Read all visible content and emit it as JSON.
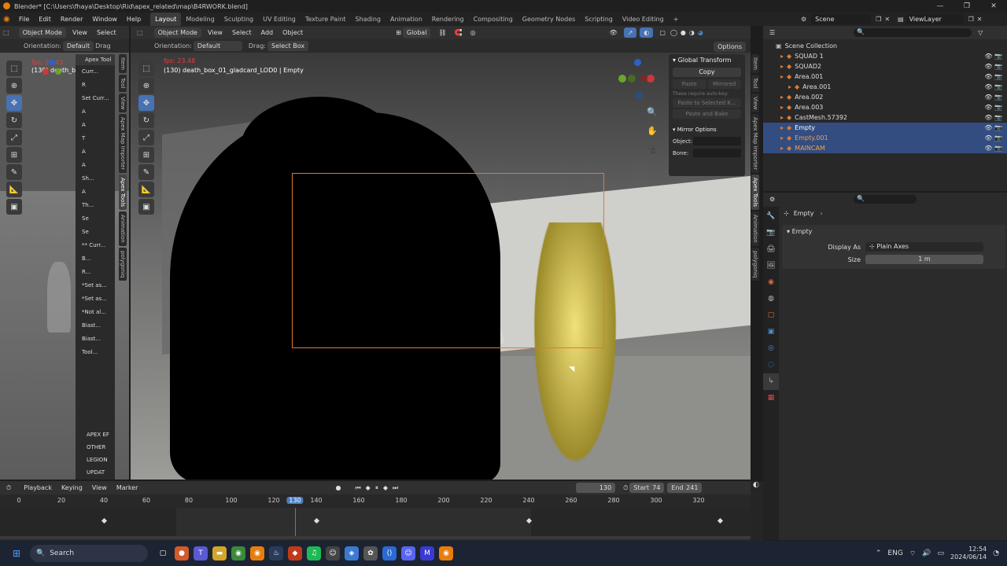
{
  "window": {
    "title": "Blender* [C:\\Users\\fhaya\\Desktop\\Rid\\apex_related\\map\\B4RWORK.blend]",
    "controls": [
      "—",
      "❐",
      "✕"
    ]
  },
  "menu": [
    "File",
    "Edit",
    "Render",
    "Window",
    "Help"
  ],
  "workspaces": [
    "Layout",
    "Modeling",
    "Sculpting",
    "UV Editing",
    "Texture Paint",
    "Shading",
    "Animation",
    "Rendering",
    "Compositing",
    "Geometry Nodes",
    "Scripting",
    "Video Editing"
  ],
  "scene": {
    "name": "Scene",
    "view_layer": "ViewLayer"
  },
  "left_view": {
    "mode": "Object Mode",
    "menus": [
      "View",
      "Select"
    ],
    "orientation_label": "Orientation:",
    "orientation": "Default",
    "drag": "Drag",
    "fps": "fps: 23.43",
    "info": "(130) death_box",
    "apex_tab": "Apex Tool",
    "rows": [
      "Curr...",
      "R",
      "Set Curr...",
      "A",
      "A",
      "T",
      "A",
      "A",
      "Sh...",
      "A",
      "Th...",
      "Se",
      "Se",
      "** Curr...",
      "B...",
      "R...",
      "*Set as...",
      "*Set as...",
      "*Not al...",
      "Biast...",
      "Biast...",
      "Tool..."
    ],
    "sections": [
      "APEX EF",
      "OTHER",
      "LEGION",
      "UPDAT"
    ]
  },
  "main_view": {
    "mode": "Object Mode",
    "menus": [
      "View",
      "Select",
      "Add",
      "Object"
    ],
    "transform": "Global",
    "orientation_label": "Orientation:",
    "orientation": "Default",
    "drag_label": "Drag:",
    "drag": "Select Box",
    "options": "Options",
    "fps": "fps: 23.48",
    "info": "(130) death_box_01_gladcard_LOD0 | Empty"
  },
  "side_tabs_left": [
    "Item",
    "Tool",
    "View",
    "Apex Map Importer",
    "Apex Tools",
    "Animation",
    "polygoniq"
  ],
  "side_tabs_main": [
    "Item",
    "Tool",
    "View",
    "Apex Map Importer",
    "Apex Tools",
    "Animation",
    "polygoniq"
  ],
  "npanel": {
    "global_title": "Global Transform",
    "copy": "Copy",
    "paste": "Paste",
    "mirrored": "Mirrored",
    "note": "These require auto-key:",
    "paste_selected": "Paste to Selected K...",
    "paste_bake": "Paste and Bake",
    "mirror_title": "Mirror Options",
    "object_label": "Object:",
    "bone_label": "Bone:"
  },
  "outliner": {
    "collection": "Scene Collection",
    "items": [
      {
        "name": "SQUAD 1",
        "indent": 1,
        "color": "#ddd",
        "sel": false
      },
      {
        "name": "SQUAD2",
        "indent": 1,
        "color": "#ddd",
        "sel": false
      },
      {
        "name": "Area.001",
        "indent": 1,
        "color": "#ddd",
        "sel": false
      },
      {
        "name": "Area.001",
        "indent": 2,
        "color": "#ddd",
        "sel": false
      },
      {
        "name": "Area.002",
        "indent": 1,
        "color": "#ddd",
        "sel": false
      },
      {
        "name": "Area.003",
        "indent": 1,
        "color": "#ddd",
        "sel": false
      },
      {
        "name": "CastMesh.57392",
        "indent": 1,
        "color": "#ddd",
        "sel": false
      },
      {
        "name": "Empty",
        "indent": 1,
        "color": "#fff",
        "sel": true
      },
      {
        "name": "Empty.001",
        "indent": 1,
        "color": "#f0a050",
        "sel": true
      },
      {
        "name": "MAINCAM",
        "indent": 1,
        "color": "#f0a050",
        "sel": true
      }
    ]
  },
  "properties": {
    "object": "Empty",
    "panel": "Empty",
    "display_as_label": "Display As",
    "display_as": "Plain Axes",
    "size_label": "Size",
    "size": "1 m"
  },
  "timeline": {
    "menus": [
      "Playback",
      "Keying",
      "View",
      "Marker"
    ],
    "current": "130",
    "start_label": "Start",
    "start": "74",
    "end_label": "End",
    "end": "241",
    "ticks": [
      0,
      20,
      40,
      60,
      80,
      100,
      120,
      130,
      140,
      160,
      180,
      200,
      220,
      240,
      260,
      280,
      300,
      320
    ],
    "keyframes": [
      40,
      140,
      240,
      330
    ]
  },
  "taskbar": {
    "search": "Search",
    "lang": "ENG",
    "time": "12:54",
    "date": "2024/06/14"
  },
  "colors": {
    "accent": "#4772b3",
    "selected": "#334d80",
    "frame": "#4a7fc4",
    "orange": "#e07a2f"
  }
}
